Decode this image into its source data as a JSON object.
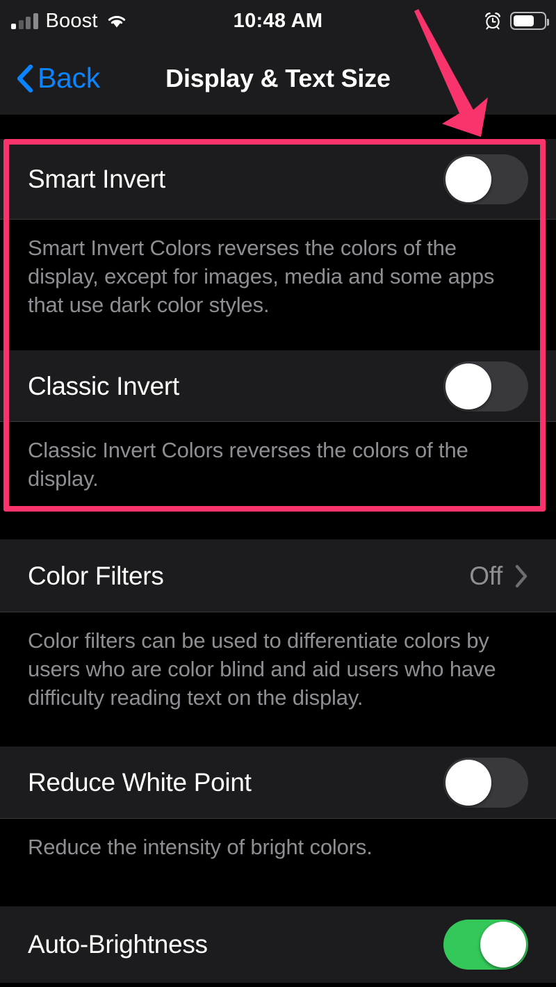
{
  "status_bar": {
    "carrier": "Boost",
    "time": "10:48 AM",
    "signal_icon": "cellular-signal-icon",
    "wifi_icon": "wifi-icon",
    "alarm_icon": "alarm-clock-icon",
    "battery_icon": "battery-icon",
    "battery_level_percent": 62
  },
  "nav_bar": {
    "back_label": "Back",
    "back_icon": "chevron-left-icon",
    "title": "Display & Text Size"
  },
  "rows": {
    "smart_invert": {
      "label": "Smart Invert",
      "toggle_state": "off",
      "footnote": "Smart Invert Colors reverses the colors of the display, except for images, media and some apps that use dark color styles."
    },
    "classic_invert": {
      "label": "Classic Invert",
      "toggle_state": "off",
      "footnote": "Classic Invert Colors reverses the colors of the display."
    },
    "color_filters": {
      "label": "Color Filters",
      "value": "Off",
      "disclosure_icon": "chevron-right-icon",
      "footnote": "Color filters can be used to differentiate colors by users who are color blind and aid users who have difficulty reading text on the display."
    },
    "reduce_white_point": {
      "label": "Reduce White Point",
      "toggle_state": "off",
      "footnote": "Reduce the intensity of bright colors."
    },
    "auto_brightness": {
      "label": "Auto-Brightness",
      "toggle_state": "on"
    }
  },
  "annotations": {
    "highlight_color": "#f9336b",
    "arrow_color": "#f9336b",
    "arrow_icon": "pointer-arrow-icon",
    "highlight_icon": "highlight-rectangle"
  },
  "colors": {
    "accent_blue": "#0a84ff",
    "toggle_on_green": "#34c759",
    "toggle_off_gray": "#39393d",
    "row_background": "#1c1c1e",
    "page_background": "#000000",
    "secondary_text": "#8e8e93"
  }
}
